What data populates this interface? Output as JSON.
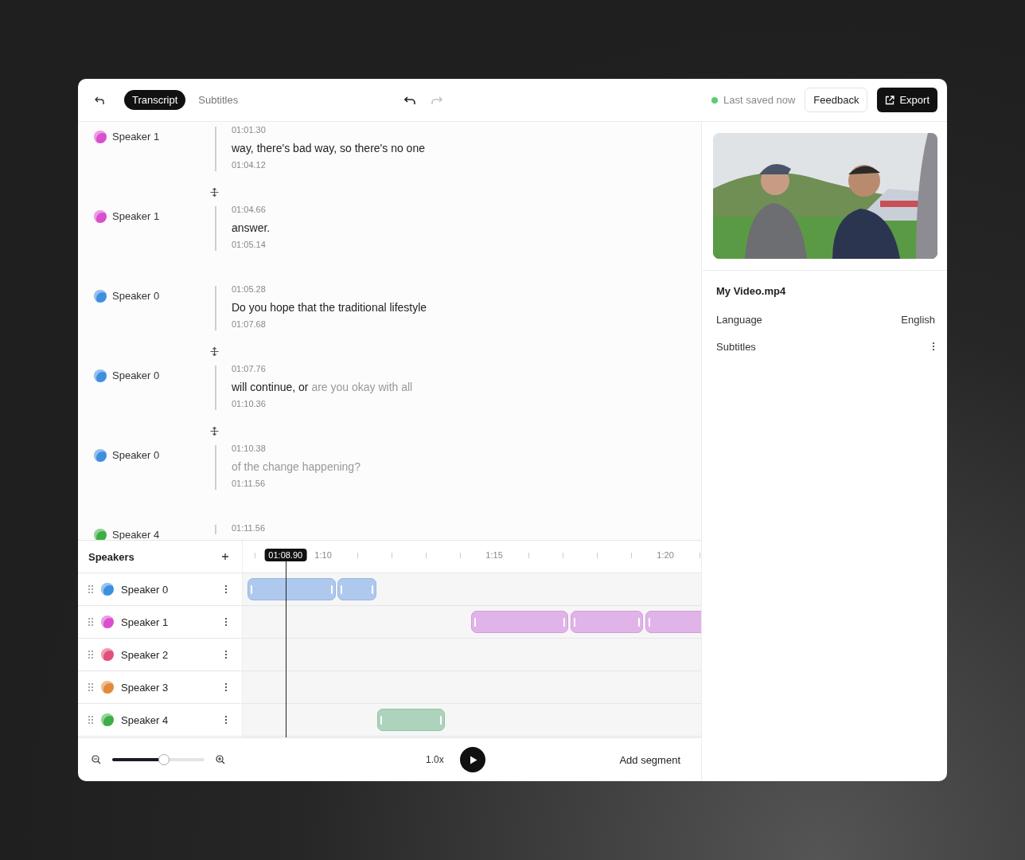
{
  "tabs": [
    {
      "label": "Transcript",
      "selected": true
    },
    {
      "label": "Subtitles",
      "selected": false
    }
  ],
  "history": {
    "undo_enabled": true,
    "redo_enabled": false
  },
  "save_status": {
    "text": "Last saved now",
    "saved": true
  },
  "feedback_button": "Feedback",
  "export_button": "Export",
  "transcript": [
    {
      "speaker": "Speaker 1",
      "color": "#d94fd0",
      "start": "01:01.30",
      "text": [
        {
          "text": "way, there's bad way, so there's no one",
          "played": true
        }
      ],
      "end": "01:04.12",
      "join_below": true
    },
    {
      "speaker": "Speaker 1",
      "color": "#d94fd0",
      "start": "01:04.66",
      "text": [
        {
          "text": "answer.",
          "played": true
        }
      ],
      "end": "01:05.14",
      "join_below": false
    },
    {
      "speaker": "Speaker 0",
      "color": "#3f8fe0",
      "start": "01:05.28",
      "text": [
        {
          "text": "Do you hope that the traditional lifestyle",
          "played": true
        }
      ],
      "end": "01:07.68",
      "join_below": true
    },
    {
      "speaker": "Speaker 0",
      "color": "#3f8fe0",
      "start": "01:07.76",
      "text": [
        {
          "text": "will continue, or",
          "played": true
        },
        {
          "text": "are you okay with all",
          "played": false
        }
      ],
      "end": "01:10.36",
      "join_below": true
    },
    {
      "speaker": "Speaker 0",
      "color": "#3f8fe0",
      "start": "01:10.38",
      "text": [
        {
          "text": "of the change happening?",
          "played": false
        }
      ],
      "end": "01:11.56",
      "join_below": false
    },
    {
      "speaker": "Speaker 4",
      "color": "#3cae45",
      "start": "01:11.56"
    }
  ],
  "timeline": {
    "title": "Speakers",
    "playhead": "01:08.90",
    "ticks": [
      "1:10",
      "1:15",
      "1:20"
    ],
    "speakers": [
      {
        "name": "Speaker 0",
        "color": "#3f8fe0"
      },
      {
        "name": "Speaker 1",
        "color": "#d94fd0"
      },
      {
        "name": "Speaker 2",
        "color": "#e0507a"
      },
      {
        "name": "Speaker 3",
        "color": "#e08a3a"
      },
      {
        "name": "Speaker 4",
        "color": "#3cae45"
      }
    ]
  },
  "footer": {
    "zoom": {
      "level": 0.56
    },
    "speed": "1.0x",
    "add_segment": "Add segment"
  },
  "details": {
    "file_name": "My Video.mp4",
    "properties": [
      {
        "kind": "value",
        "label": "Language",
        "value": "English"
      },
      {
        "kind": "menu",
        "label": "Subtitles"
      }
    ]
  }
}
